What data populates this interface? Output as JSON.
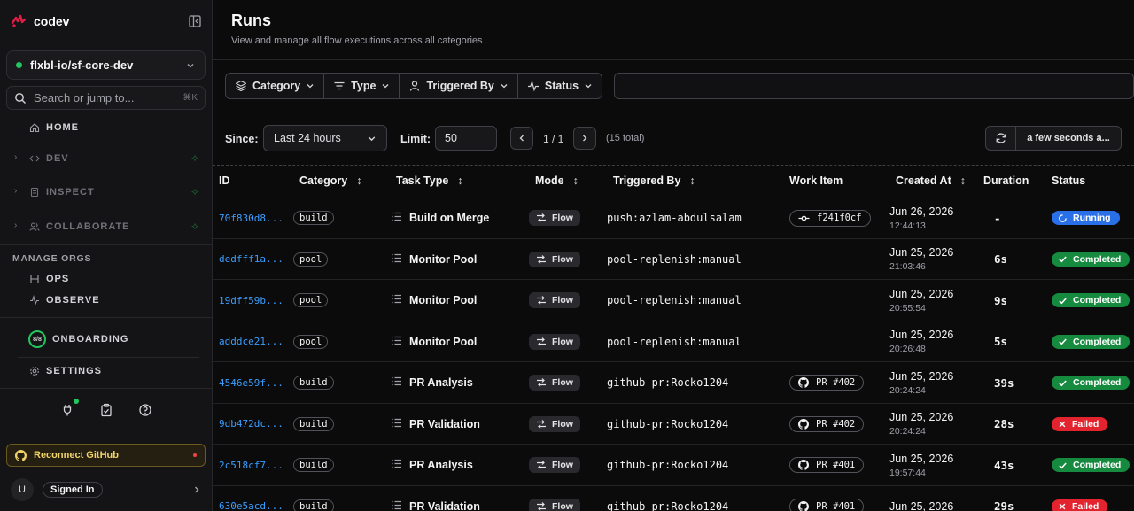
{
  "app": {
    "name": "codev",
    "brand_color": "#e11d48"
  },
  "sidebar": {
    "project": "flxbl-io/sf-core-dev",
    "search_placeholder": "Search or jump to...",
    "search_shortcut": "⌘K",
    "home": "HOME",
    "groups": [
      {
        "label": "DEV",
        "icon": "code-icon"
      },
      {
        "label": "INSPECT",
        "icon": "inspect-icon"
      },
      {
        "label": "COLLABORATE",
        "icon": "users-icon"
      }
    ],
    "manage_orgs_label": "MANAGE ORGS",
    "ops": "OPS",
    "observe": "OBSERVE",
    "onboarding_progress": "8/8",
    "onboarding": "ONBOARDING",
    "settings": "SETTINGS",
    "reconnect": "Reconnect GitHub",
    "user_initial": "U",
    "signed_in": "Signed In"
  },
  "header": {
    "title": "Runs",
    "subtitle": "View and manage all flow executions across all categories"
  },
  "filters": {
    "category": "Category",
    "type": "Type",
    "triggered_by": "Triggered By",
    "status": "Status",
    "search_value": ""
  },
  "controls": {
    "since_label": "Since:",
    "since_value": "Last 24 hours",
    "limit_label": "Limit:",
    "limit_value": "50",
    "page": "1 / 1",
    "total": "(15 total)",
    "refresh": "a few seconds a..."
  },
  "columns": {
    "id": "ID",
    "category": "Category",
    "task_type": "Task Type",
    "mode": "Mode",
    "triggered_by": "Triggered By",
    "work_item": "Work Item",
    "created_at": "Created At",
    "duration": "Duration",
    "status": "Status"
  },
  "runs": [
    {
      "id": "70f830d8...",
      "category": "build",
      "task": "Build on Merge",
      "mode": "Flow",
      "triggered_by": "push:azlam-abdulsalam",
      "work_item": "f241f0cf",
      "work_item_type": "commit",
      "date": "Jun 26, 2026",
      "time": "12:44:13",
      "duration": "-",
      "status": "Running"
    },
    {
      "id": "dedfff1a...",
      "category": "pool",
      "task": "Monitor Pool",
      "mode": "Flow",
      "triggered_by": "pool-replenish:manual",
      "work_item": "",
      "work_item_type": "",
      "date": "Jun 25, 2026",
      "time": "21:03:46",
      "duration": "6s",
      "status": "Completed"
    },
    {
      "id": "19dff59b...",
      "category": "pool",
      "task": "Monitor Pool",
      "mode": "Flow",
      "triggered_by": "pool-replenish:manual",
      "work_item": "",
      "work_item_type": "",
      "date": "Jun 25, 2026",
      "time": "20:55:54",
      "duration": "9s",
      "status": "Completed"
    },
    {
      "id": "adddce21...",
      "category": "pool",
      "task": "Monitor Pool",
      "mode": "Flow",
      "triggered_by": "pool-replenish:manual",
      "work_item": "",
      "work_item_type": "",
      "date": "Jun 25, 2026",
      "time": "20:26:48",
      "duration": "5s",
      "status": "Completed"
    },
    {
      "id": "4546e59f...",
      "category": "build",
      "task": "PR Analysis",
      "mode": "Flow",
      "triggered_by": "github-pr:Rocko1204",
      "work_item": "PR #402",
      "work_item_type": "github",
      "date": "Jun 25, 2026",
      "time": "20:24:24",
      "duration": "39s",
      "status": "Completed"
    },
    {
      "id": "9db472dc...",
      "category": "build",
      "task": "PR Validation",
      "mode": "Flow",
      "triggered_by": "github-pr:Rocko1204",
      "work_item": "PR #402",
      "work_item_type": "github",
      "date": "Jun 25, 2026",
      "time": "20:24:24",
      "duration": "28s",
      "status": "Failed"
    },
    {
      "id": "2c518cf7...",
      "category": "build",
      "task": "PR Analysis",
      "mode": "Flow",
      "triggered_by": "github-pr:Rocko1204",
      "work_item": "PR #401",
      "work_item_type": "github",
      "date": "Jun 25, 2026",
      "time": "19:57:44",
      "duration": "43s",
      "status": "Completed"
    },
    {
      "id": "630e5acd...",
      "category": "build",
      "task": "PR Validation",
      "mode": "Flow",
      "triggered_by": "github-pr:Rocko1204",
      "work_item": "PR #401",
      "work_item_type": "github",
      "date": "Jun 25, 2026",
      "time": "",
      "duration": "29s",
      "status": "Failed"
    }
  ]
}
